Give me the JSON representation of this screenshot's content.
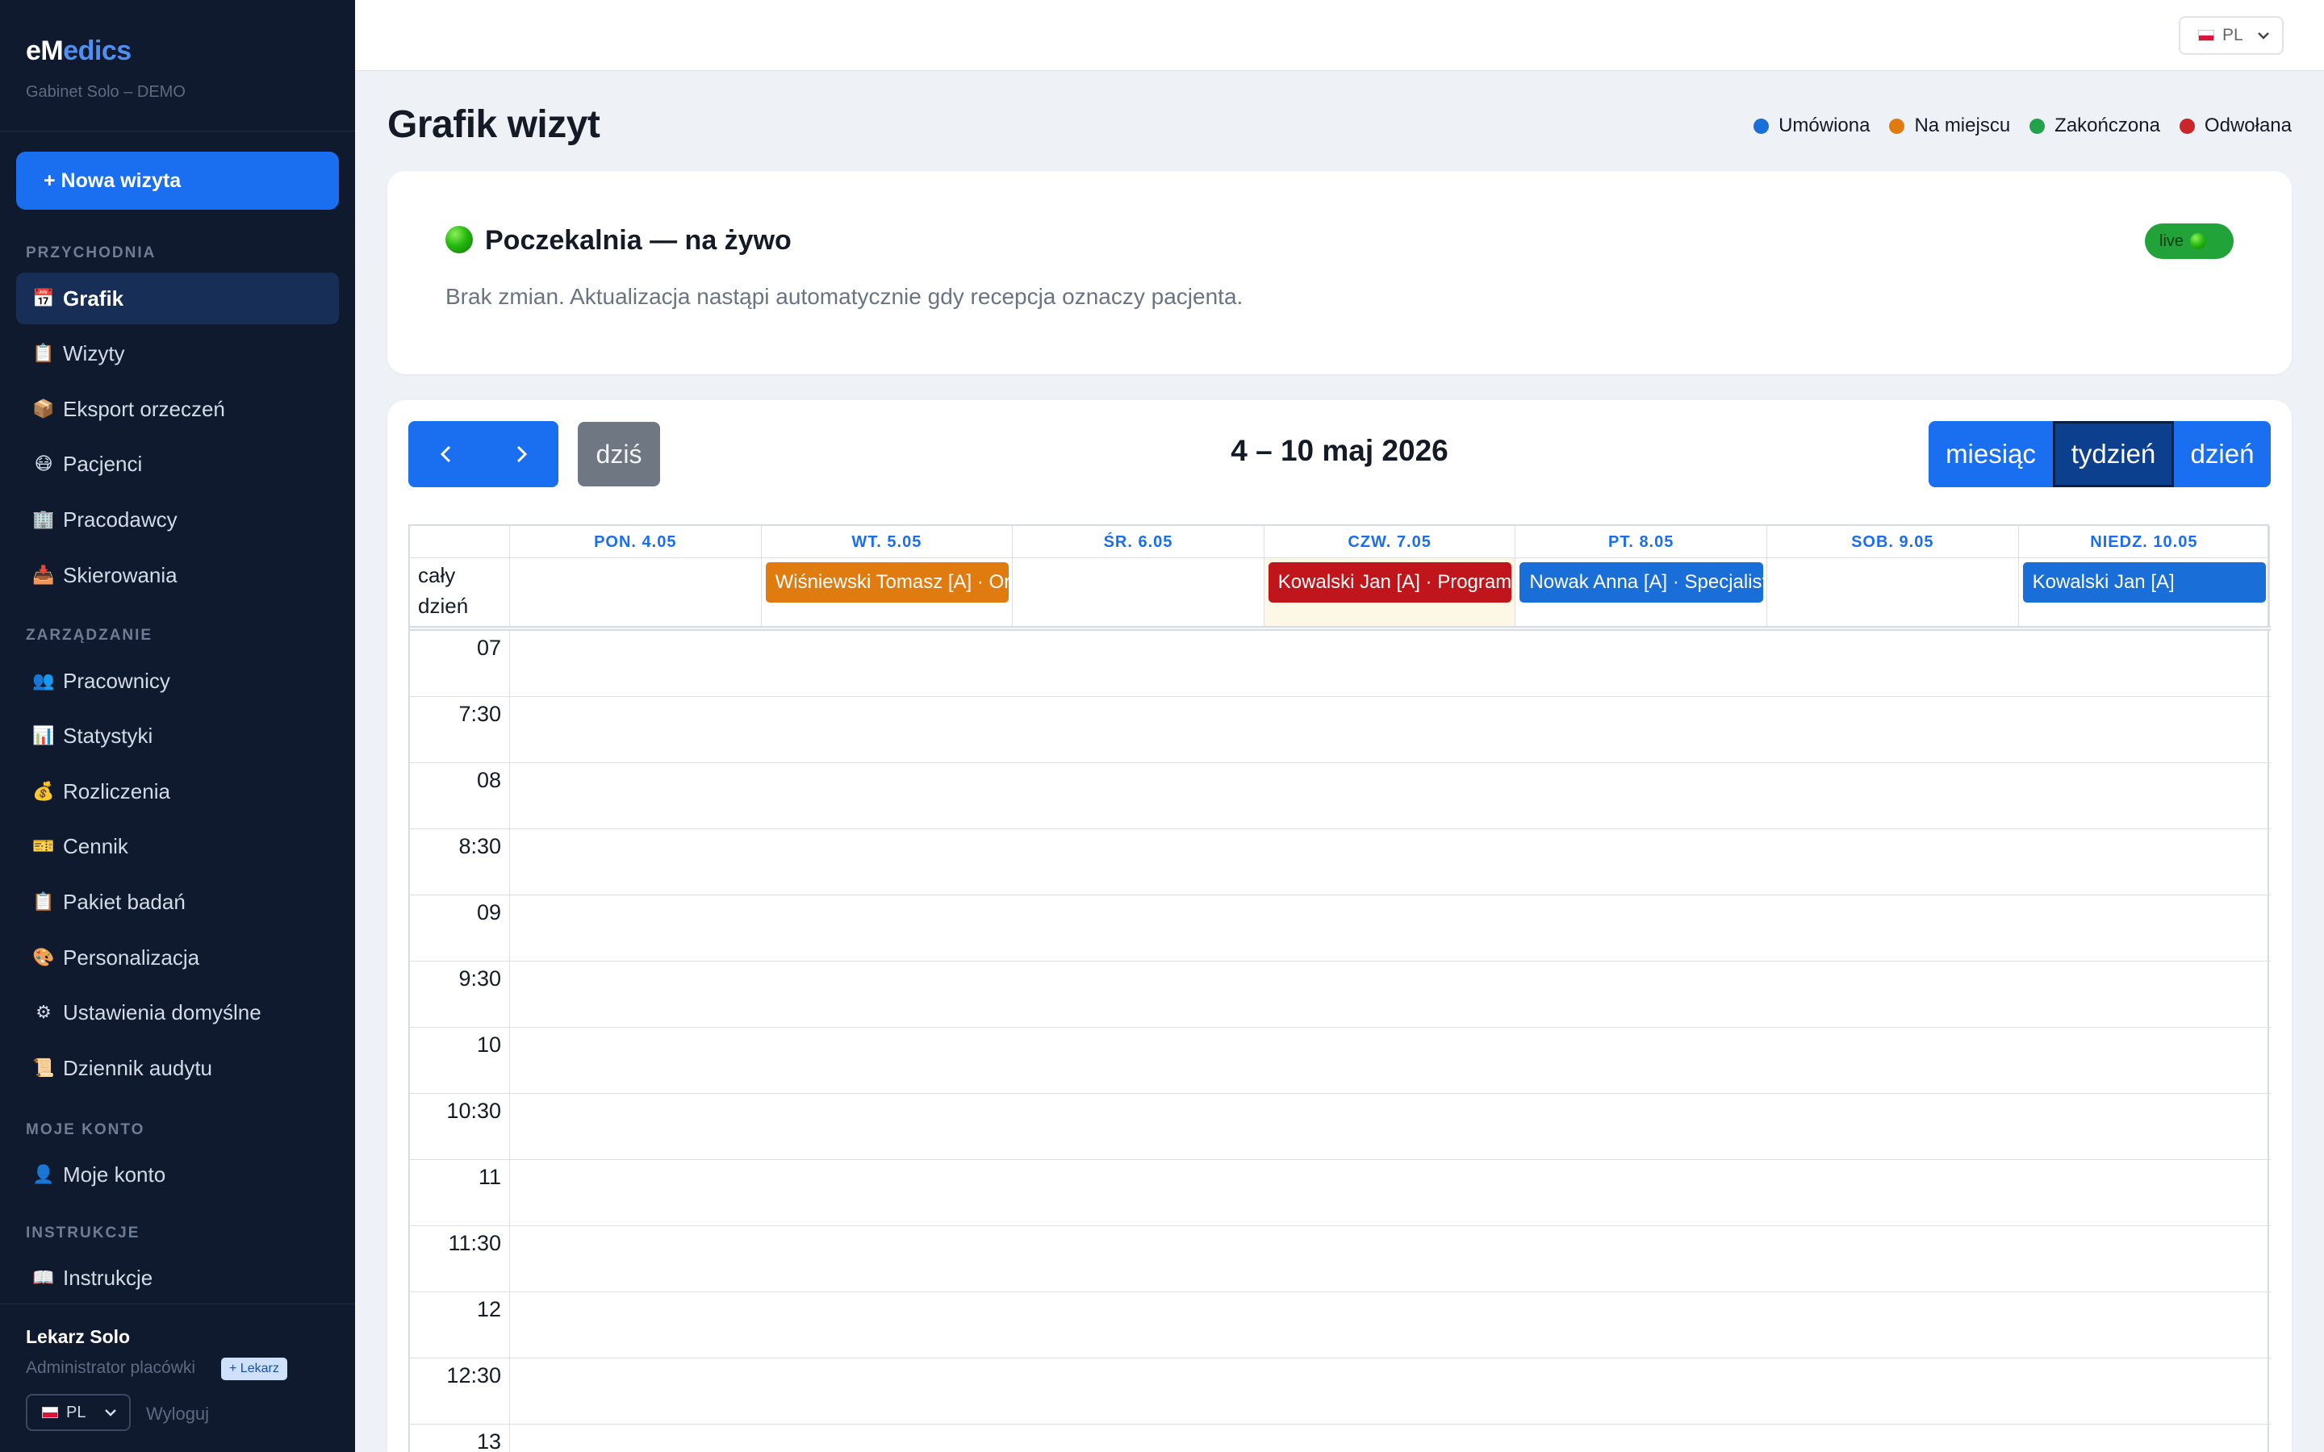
{
  "app": {
    "brand_prefix": "eM",
    "brand_suffix": "edics",
    "clinic": "Gabinet Solo – DEMO"
  },
  "sidebar": {
    "new_visit": "+ Nowa wizyta",
    "sections": [
      {
        "title": "PRZYCHODNIA",
        "items": [
          {
            "icon": "calendar-icon",
            "glyph": "📅",
            "label": "Grafik",
            "active": true
          },
          {
            "icon": "clipboard-icon",
            "glyph": "📋",
            "label": "Wizyty"
          },
          {
            "icon": "package-icon",
            "glyph": "📦",
            "label": "Eksport orzeczeń"
          },
          {
            "icon": "patient-face-icon",
            "glyph": "😷",
            "label": "Pacjenci"
          },
          {
            "icon": "office-building-icon",
            "glyph": "🏢",
            "label": "Pracodawcy"
          },
          {
            "icon": "inbox-tray-icon",
            "glyph": "📥",
            "label": "Skierowania"
          }
        ]
      },
      {
        "title": "ZARZĄDZANIE",
        "items": [
          {
            "icon": "people-icon",
            "glyph": "👥",
            "label": "Pracownicy"
          },
          {
            "icon": "bar-chart-icon",
            "glyph": "📊",
            "label": "Statystyki"
          },
          {
            "icon": "money-bag-icon",
            "glyph": "💰",
            "label": "Rozliczenia"
          },
          {
            "icon": "ticket-icon",
            "glyph": "🎫",
            "label": "Cennik"
          },
          {
            "icon": "clipboard-icon",
            "glyph": "📋",
            "label": "Pakiet badań"
          },
          {
            "icon": "palette-icon",
            "glyph": "🎨",
            "label": "Personalizacja"
          },
          {
            "icon": "gear-icon",
            "glyph": "⚙",
            "label": "Ustawienia domyślne"
          },
          {
            "icon": "scroll-icon",
            "glyph": "📜",
            "label": "Dziennik audytu"
          }
        ]
      },
      {
        "title": "MOJE KONTO",
        "items": [
          {
            "icon": "user-icon",
            "glyph": "👤",
            "label": "Moje konto"
          }
        ]
      },
      {
        "title": "INSTRUKCJE",
        "items": [
          {
            "icon": "open-book-icon",
            "glyph": "📖",
            "label": "Instrukcje"
          }
        ]
      }
    ],
    "user": {
      "name": "Lekarz Solo",
      "role": "Administrator placówki",
      "badge": "+ Lekarz",
      "lang": "PL",
      "logout": "Wyloguj"
    }
  },
  "topbar": {
    "lang": "PL"
  },
  "page": {
    "title": "Grafik wizyt"
  },
  "legend": [
    {
      "label": "Umówiona",
      "color": "#1a6ed8"
    },
    {
      "label": "Na miejscu",
      "color": "#e07b10"
    },
    {
      "label": "Zakończona",
      "color": "#22a34a"
    },
    {
      "label": "Odwołana",
      "color": "#c9252b"
    }
  ],
  "waiting_room": {
    "title": "Poczekalnia — na żywo",
    "live": "live",
    "message": "Brak zmian. Aktualizacja nastąpi automatycznie gdy recepcja oznaczy pacjenta."
  },
  "calendar": {
    "today_label": "dziś",
    "range": "4 – 10 maj 2026",
    "views": [
      "miesiąc",
      "tydzień",
      "dzień"
    ],
    "active_view": "tydzień",
    "allday_label": "cały dzień",
    "days": [
      "PON. 4.05",
      "WT. 5.05",
      "ŚR. 6.05",
      "CZW. 7.05",
      "PT. 8.05",
      "SOB. 9.05",
      "NIEDZ. 10.05"
    ],
    "today_index": 3,
    "allday_events": [
      {
        "day": 1,
        "title": "Wiśniewski Tomasz [A] · Orzeczenie",
        "color": "#e07b10"
      },
      {
        "day": 3,
        "title": "Kowalski Jan [A] · Program",
        "color": "#c0161b"
      },
      {
        "day": 4,
        "title": "Nowak Anna [A] · Specjalista",
        "color": "#1a6ed8"
      },
      {
        "day": 6,
        "title": "Kowalski Jan [A]",
        "color": "#1a6ed8"
      }
    ],
    "time_slots": [
      "07",
      "7:30",
      "08",
      "8:30",
      "09",
      "9:30",
      "10",
      "10:30",
      "11",
      "11:30",
      "12",
      "12:30",
      "13"
    ]
  }
}
